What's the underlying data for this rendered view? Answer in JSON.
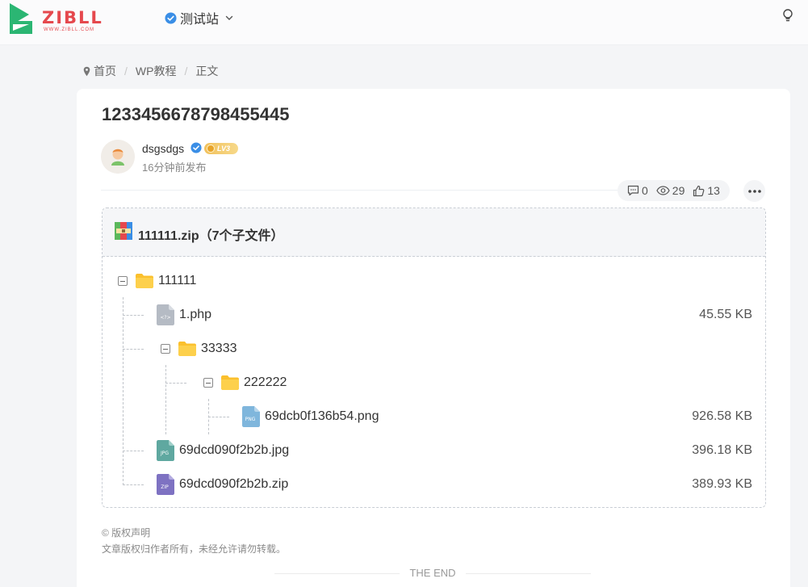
{
  "header": {
    "logo_text": "ZIBLL",
    "logo_sub": "WWW.ZIBLL.COM",
    "site_name": "测试站"
  },
  "breadcrumb": {
    "items": [
      "首页",
      "WP教程",
      "正文"
    ],
    "separator": "/"
  },
  "post": {
    "title": "1233456678798455445",
    "author": {
      "name": "dsgsdgs",
      "level": "LV3"
    },
    "published": "16分钟前发布",
    "stats": {
      "comments": "0",
      "views": "29",
      "likes": "13"
    }
  },
  "zip": {
    "title": "111111.zip（7个子文件）",
    "tree": [
      {
        "name": "111111",
        "type": "folder",
        "size": ""
      },
      {
        "name": "1.php",
        "type": "file",
        "ext": "php",
        "size": "45.55 KB"
      },
      {
        "name": "33333",
        "type": "folder",
        "size": ""
      },
      {
        "name": "222222",
        "type": "folder",
        "size": ""
      },
      {
        "name": "69dcb0f136b54.png",
        "type": "file",
        "ext": "PNG",
        "size": "926.58 KB"
      },
      {
        "name": "69dcd090f2b2b.jpg",
        "type": "file",
        "ext": "JPG",
        "size": "396.18 KB"
      },
      {
        "name": "69dcd090f2b2b.zip",
        "type": "file",
        "ext": "ZIP",
        "size": "389.93 KB"
      }
    ]
  },
  "copyright": {
    "title": "© 版权声明",
    "text": "文章版权归作者所有，未经允许请勿转载。"
  },
  "end_text": "THE END",
  "colors": {
    "brand": "#e5484d",
    "logo_green": "#2bb673",
    "verified": "#3a8ee6",
    "folder": "#fbc02d",
    "jpg": "#5fa8a0",
    "png": "#7fb6dc",
    "zip": "#7e72c2"
  }
}
